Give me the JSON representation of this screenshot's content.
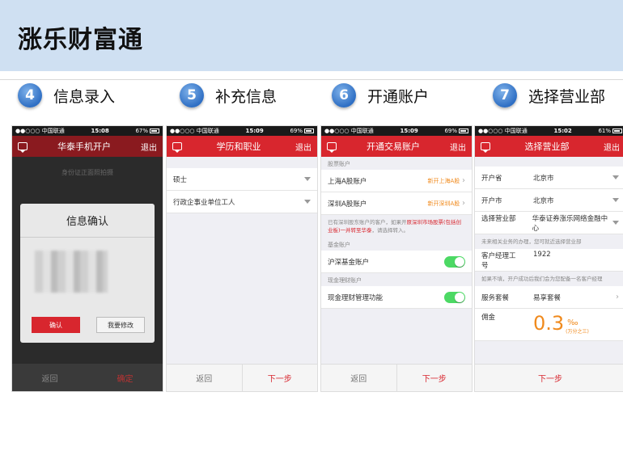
{
  "header": {
    "title": "涨乐财富通"
  },
  "steps": [
    {
      "number": "4",
      "label": "信息录入"
    },
    {
      "number": "5",
      "label": "补充信息"
    },
    {
      "number": "6",
      "label": "开通账户"
    },
    {
      "number": "7",
      "label": "选择营业部"
    }
  ],
  "phone1": {
    "status": {
      "carrier": "●●○○○ 中国联通",
      "time": "15:08",
      "battery": "67%"
    },
    "nav_title": "华泰手机开户",
    "exit": "退出",
    "faint_text": "身份证正面照拍摄",
    "modal_title": "信息确认",
    "confirm": "确认",
    "modify": "我要修改",
    "back": "返回",
    "next": "确定"
  },
  "phone2": {
    "status": {
      "carrier": "●●○○○ 中国联通",
      "time": "15:09",
      "battery": "69%"
    },
    "nav_title": "学历和职业",
    "exit": "退出",
    "education": "硕士",
    "occupation": "行政企事业单位工人",
    "back": "返回",
    "next": "下一步"
  },
  "phone3": {
    "status": {
      "carrier": "●●○○○ 中国联通",
      "time": "15:09",
      "battery": "69%"
    },
    "nav_title": "开通交易账户",
    "exit": "退出",
    "section_stock": "股票账户",
    "sh_label": "上海A股账户",
    "sh_action": "新开上海A股",
    "sz_label": "深圳A股账户",
    "sz_action": "新开深圳A股",
    "note_pre": "已有深圳股东账户的客户，如果开",
    "note_red": "原深圳市场股票(包括创业板)一并转至华泰",
    "note_post": "，请选择转入。",
    "section_fund": "基金账户",
    "fund_label": "沪深基金账户",
    "section_cash": "现金理财账户",
    "cash_label": "现金理财管理功能",
    "back": "返回",
    "next": "下一步"
  },
  "phone4": {
    "status": {
      "carrier": "●●○○○ 中国联通",
      "time": "15:02",
      "battery": "61%"
    },
    "nav_title": "选择营业部",
    "exit": "退出",
    "province_label": "开户省",
    "province_value": "北京市",
    "city_label": "开户市",
    "city_value": "北京市",
    "branch_label": "选择营业部",
    "branch_value": "华泰证券涨乐网络金融中心",
    "branch_note": "未来相关业务的办理，您可就近选择营业部",
    "manager_label": "客户经理工号",
    "manager_value": "1922",
    "manager_note": "如果不填，开户成功后我们会为您配备一名客户经理",
    "package_label": "服务套餐",
    "package_value": "易享套餐",
    "commission_label": "佣金",
    "commission_value": "0.3",
    "commission_unit": "‰",
    "commission_note": "(万分之三)",
    "next": "下一步"
  },
  "colors": {
    "brand_red": "#d8262e",
    "accent_orange": "#f08a1d",
    "toggle_green": "#4cd964",
    "banner": "#cfe0f2"
  }
}
